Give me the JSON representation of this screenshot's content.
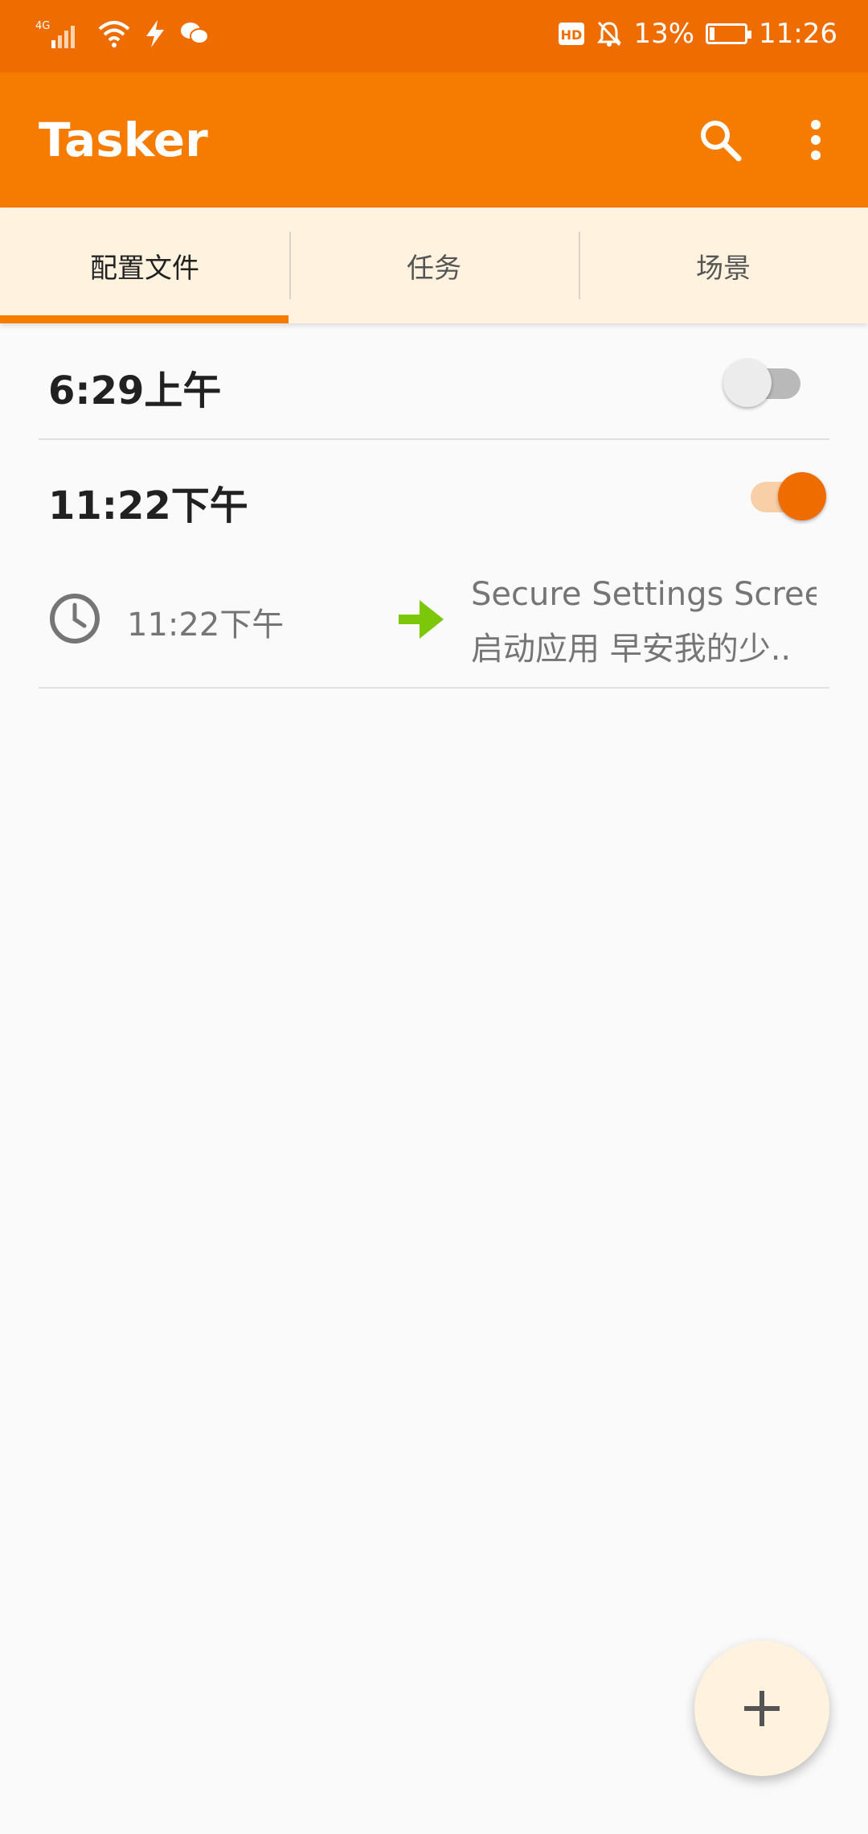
{
  "status_bar": {
    "network": "4G",
    "icons": [
      "signal-icon",
      "wifi-icon",
      "flash-icon",
      "wechat-icon",
      "hd-icon",
      "mute-icon",
      "battery-icon"
    ],
    "hd_label": "HD",
    "battery_percent": "13%",
    "battery_level": 0.13,
    "time": "11:26"
  },
  "app_bar": {
    "title": "Tasker",
    "search_icon": "search-icon",
    "menu_icon": "more-vert-icon"
  },
  "tabs": [
    {
      "label": "配置文件",
      "active": true
    },
    {
      "label": "任务",
      "active": false
    },
    {
      "label": "场景",
      "active": false
    }
  ],
  "profiles": [
    {
      "name": "6:29上午",
      "enabled": false
    },
    {
      "name": "11:22下午",
      "enabled": true,
      "context": {
        "icon": "clock-icon",
        "text": "11:22下午"
      },
      "task": {
        "icon": "arrow-right-icon",
        "line1": "Secure Settings Scree..",
        "line2": "启动应用 早安我的少.."
      }
    }
  ],
  "fab": {
    "icon": "plus-icon"
  },
  "colors": {
    "status_bar": "#ef6c00",
    "app_bar": "#f57c00",
    "tab_bar": "#fff3e0",
    "accent": "#ef6c00",
    "arrow": "#7cc70a"
  }
}
